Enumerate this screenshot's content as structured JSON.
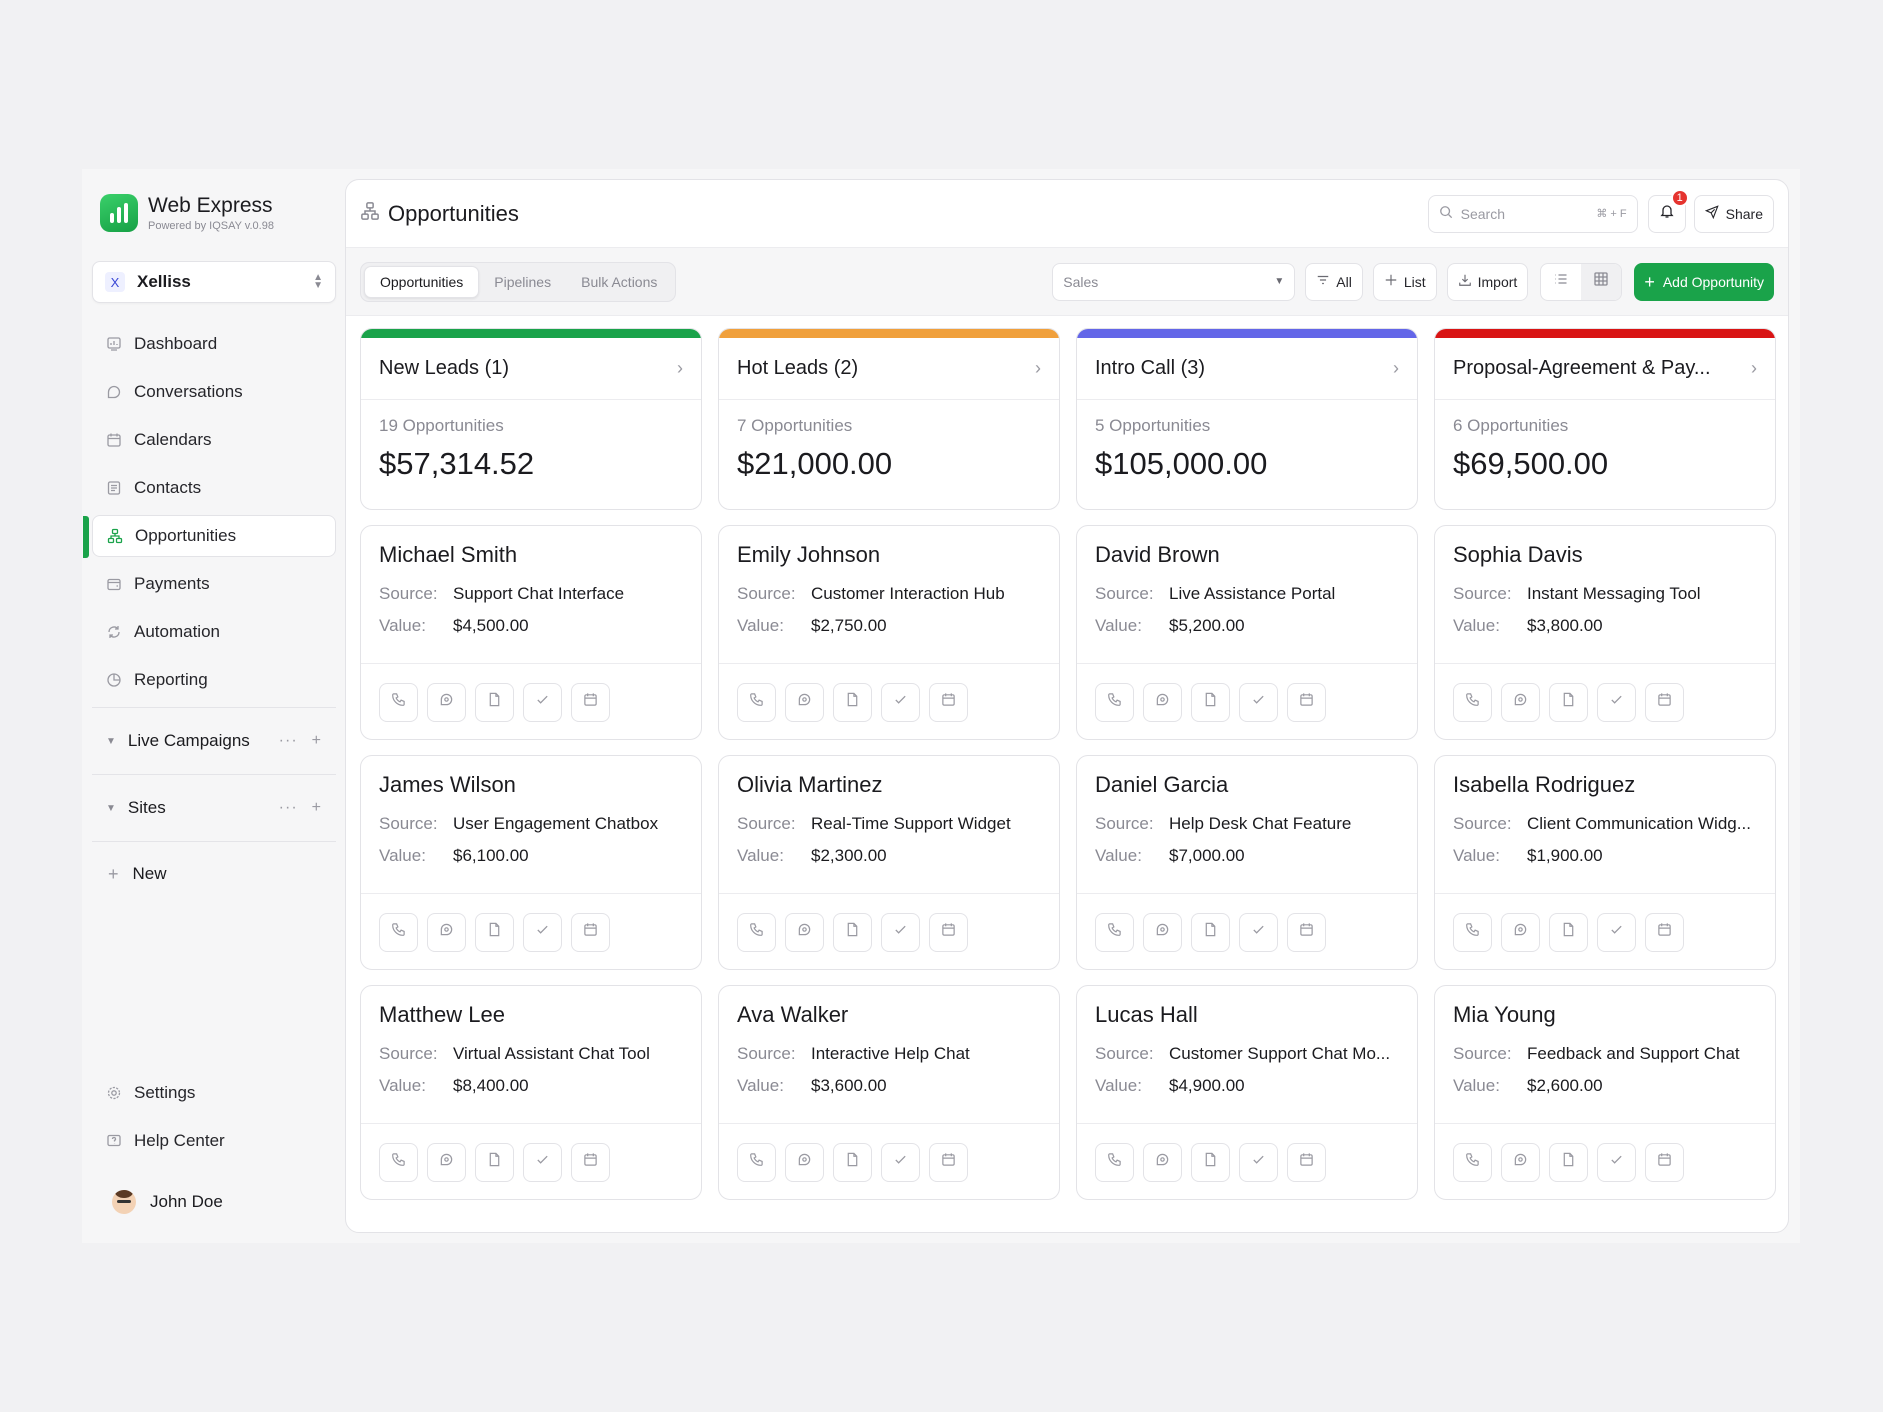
{
  "brand": {
    "title": "Web Express",
    "subtitle": "Powered by IQSAY  v.0.98"
  },
  "workspace": {
    "badge": "X",
    "name": "Xelliss"
  },
  "nav": [
    {
      "label": "Dashboard",
      "icon": "dashboard-icon"
    },
    {
      "label": "Conversations",
      "icon": "chat-icon"
    },
    {
      "label": "Calendars",
      "icon": "calendar-icon"
    },
    {
      "label": "Contacts",
      "icon": "contacts-icon"
    },
    {
      "label": "Opportunities",
      "icon": "sitemap-icon",
      "active": true
    },
    {
      "label": "Payments",
      "icon": "wallet-icon"
    },
    {
      "label": "Automation",
      "icon": "automation-icon"
    },
    {
      "label": "Reporting",
      "icon": "pie-chart-icon"
    }
  ],
  "groups": [
    {
      "label": "Live Campaigns"
    },
    {
      "label": "Sites"
    }
  ],
  "new_label": "New",
  "bottom_nav": [
    {
      "label": "Settings",
      "icon": "gear-icon"
    },
    {
      "label": "Help Center",
      "icon": "help-icon"
    }
  ],
  "user": {
    "name": "John Doe"
  },
  "header": {
    "title": "Opportunities",
    "search_placeholder": "Search",
    "search_shortcut": "⌘ + F",
    "notifications": "1",
    "share_label": "Share"
  },
  "toolbar": {
    "tabs": [
      "Opportunities",
      "Pipelines",
      "Bulk Actions"
    ],
    "pipeline_select": "Sales",
    "all_label": "All",
    "list_label": "List",
    "import_label": "Import",
    "add_label": "Add Opportunity"
  },
  "colors": {
    "accent": "#1aa34a",
    "new_leads": "#1aa34a",
    "hot_leads": "#f0a03c",
    "intro_call": "#6366e8",
    "proposal": "#d91414"
  },
  "columns": [
    {
      "title": "New Leads (1)",
      "color": "#1aa34a",
      "count": "19 Opportunities",
      "total": "$57,314.52",
      "cards": [
        {
          "name": "Michael Smith",
          "source": "Support Chat Interface",
          "value": "$4,500.00"
        },
        {
          "name": "James Wilson",
          "source": "User Engagement Chatbox",
          "value": "$6,100.00"
        },
        {
          "name": "Matthew Lee",
          "source": "Virtual Assistant Chat Tool",
          "value": "$8,400.00"
        }
      ]
    },
    {
      "title": "Hot Leads (2)",
      "color": "#f0a03c",
      "count": "7 Opportunities",
      "total": "$21,000.00",
      "cards": [
        {
          "name": "Emily Johnson",
          "source": "Customer Interaction Hub",
          "value": "$2,750.00"
        },
        {
          "name": "Olivia Martinez",
          "source": "Real-Time Support Widget",
          "value": "$2,300.00"
        },
        {
          "name": "Ava Walker",
          "source": "Interactive Help Chat",
          "value": "$3,600.00"
        }
      ]
    },
    {
      "title": "Intro Call (3)",
      "color": "#6366e8",
      "count": "5 Opportunities",
      "total": "$105,000.00",
      "cards": [
        {
          "name": "David Brown",
          "source": "Live Assistance Portal",
          "value": "$5,200.00"
        },
        {
          "name": "Daniel Garcia",
          "source": "Help Desk Chat Feature",
          "value": "$7,000.00"
        },
        {
          "name": "Lucas Hall",
          "source": "Customer Support Chat Mo...",
          "value": "$4,900.00"
        }
      ]
    },
    {
      "title": "Proposal-Agreement & Pay...",
      "color": "#d91414",
      "count": "6 Opportunities",
      "total": "$69,500.00",
      "cards": [
        {
          "name": "Sophia Davis",
          "source": "Instant Messaging Tool",
          "value": "$3,800.00"
        },
        {
          "name": "Isabella Rodriguez",
          "source": "Client Communication Widg...",
          "value": "$1,900.00"
        },
        {
          "name": "Mia Young",
          "source": "Feedback and Support Chat",
          "value": "$2,600.00"
        }
      ]
    }
  ],
  "card_labels": {
    "source": "Source:",
    "value": "Value:"
  },
  "card_action_icons": [
    "phone-icon",
    "chat-icon",
    "document-icon",
    "check-icon",
    "calendar-icon"
  ]
}
